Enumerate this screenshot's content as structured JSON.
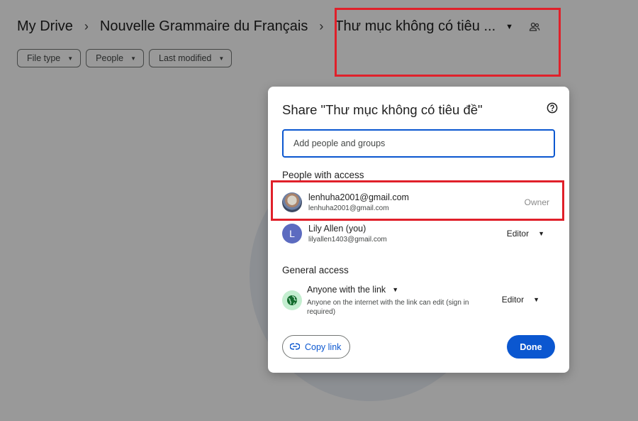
{
  "breadcrumb": {
    "root": "My Drive",
    "parent": "Nouvelle Grammaire du Français",
    "current": "Thư mục không có tiêu ...",
    "separator": "›"
  },
  "filters": [
    {
      "label": "File type"
    },
    {
      "label": "People"
    },
    {
      "label": "Last modified"
    }
  ],
  "dialog": {
    "title": "Share \"Thư mục không có tiêu đề\"",
    "add_placeholder": "Add people and groups",
    "people_section": "People with access",
    "people": [
      {
        "name": "lenhuha2001@gmail.com",
        "email": "lenhuha2001@gmail.com",
        "role": "Owner",
        "avatar": "photo"
      },
      {
        "name": "Lily Allen (you)",
        "email": "lilyallen1403@gmail.com",
        "role": "Editor",
        "avatar": "L"
      }
    ],
    "general_section": "General access",
    "general": {
      "link_setting": "Anyone with the link",
      "description": "Anyone on the internet with the link can edit (sign in required)",
      "role": "Editor"
    },
    "copy_link": "Copy link",
    "done": "Done"
  },
  "colors": {
    "accent": "#0b57d0",
    "highlight": "#e0202a",
    "avatar_letter_bg": "#5c6bc0",
    "globe_bg": "#c4eed0"
  }
}
